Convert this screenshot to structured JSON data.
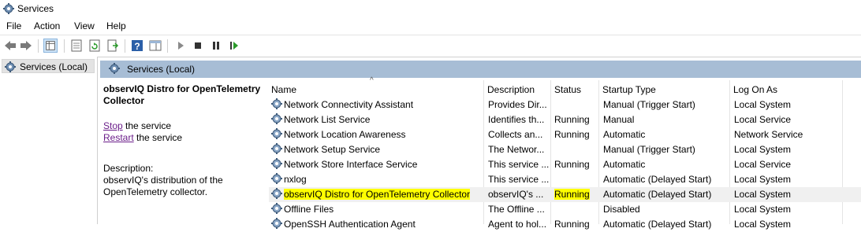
{
  "window": {
    "title": "Services"
  },
  "menu": [
    "File",
    "Action",
    "View",
    "Help"
  ],
  "tree": {
    "root_label": "Services (Local)"
  },
  "header": {
    "title": "Services (Local)"
  },
  "details": {
    "service_name": "observIQ Distro for OpenTelemetry Collector",
    "stop_link": "Stop",
    "stop_suffix": " the service",
    "restart_link": "Restart",
    "restart_suffix": " the service",
    "description_label": "Description:",
    "description_text": "observIQ's distribution of the OpenTelemetry collector."
  },
  "columns": [
    "Name",
    "Description",
    "Status",
    "Startup Type",
    "Log On As"
  ],
  "rows": [
    {
      "name": "Network Connectivity Assistant",
      "description": "Provides Dir...",
      "status": "",
      "startup": "Manual (Trigger Start)",
      "logon": "Local System"
    },
    {
      "name": "Network List Service",
      "description": "Identifies th...",
      "status": "Running",
      "startup": "Manual",
      "logon": "Local Service"
    },
    {
      "name": "Network Location Awareness",
      "description": "Collects an...",
      "status": "Running",
      "startup": "Automatic",
      "logon": "Network Service"
    },
    {
      "name": "Network Setup Service",
      "description": "The Networ...",
      "status": "",
      "startup": "Manual (Trigger Start)",
      "logon": "Local System"
    },
    {
      "name": "Network Store Interface Service",
      "description": "This service ...",
      "status": "Running",
      "startup": "Automatic",
      "logon": "Local Service"
    },
    {
      "name": "nxlog",
      "description": "This service ...",
      "status": "",
      "startup": "Automatic (Delayed Start)",
      "logon": "Local System"
    },
    {
      "name": "observIQ Distro for OpenTelemetry Collector",
      "description": "observIQ's ...",
      "status": "Running",
      "startup": "Automatic (Delayed Start)",
      "logon": "Local System",
      "selected": true
    },
    {
      "name": "Offline Files",
      "description": "The Offline ...",
      "status": "",
      "startup": "Disabled",
      "logon": "Local System"
    },
    {
      "name": "OpenSSH Authentication Agent",
      "description": "Agent to hol...",
      "status": "Running",
      "startup": "Automatic (Delayed Start)",
      "logon": "Local System"
    }
  ],
  "colors": {
    "header_bar": "#a7bdd5",
    "highlight": "#ffff00",
    "link": "#6b1e8a"
  },
  "icons": [
    "gear-icon",
    "back-icon",
    "forward-icon",
    "play-icon",
    "stop-icon",
    "pause-icon",
    "restart-icon"
  ]
}
